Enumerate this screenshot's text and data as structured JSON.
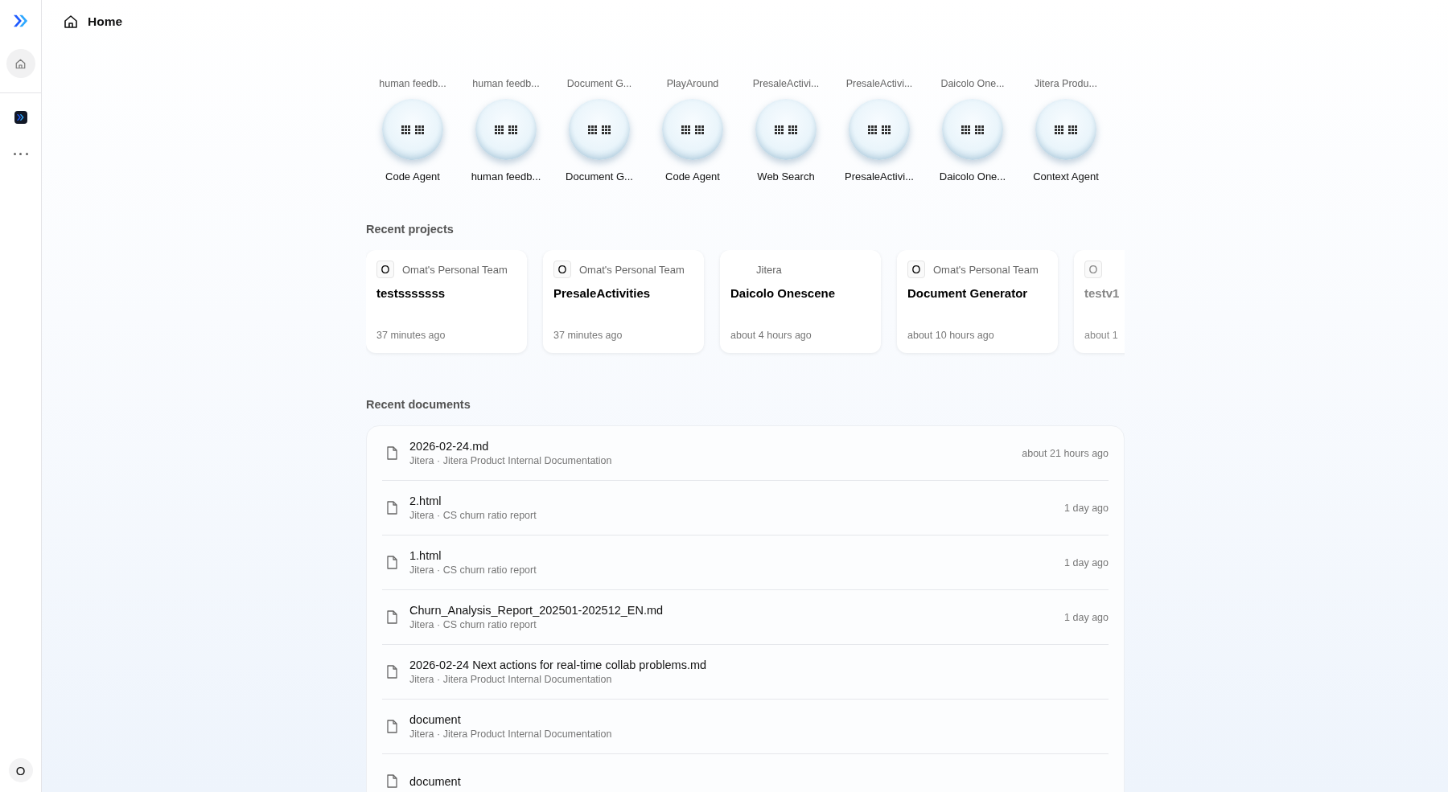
{
  "sidebar": {
    "items": [
      {
        "kind": "home",
        "selected": true
      },
      {
        "kind": "app",
        "selected": false
      },
      {
        "kind": "more",
        "selected": false
      }
    ],
    "avatar": "O"
  },
  "header": {
    "title": "Home"
  },
  "agents": [
    {
      "project": "human feedb...",
      "name": "Code Agent"
    },
    {
      "project": "human feedb...",
      "name": "human feedb..."
    },
    {
      "project": "Document G...",
      "name": "Document G..."
    },
    {
      "project": "PlayAround",
      "name": "Code Agent"
    },
    {
      "project": "PresaleActivi...",
      "name": "Web Search"
    },
    {
      "project": "PresaleActivi...",
      "name": "PresaleActivi..."
    },
    {
      "project": "Daicolo One...",
      "name": "Daicolo One..."
    },
    {
      "project": "Jitera Produ...",
      "name": "Context Agent"
    }
  ],
  "recent_projects": {
    "title": "Recent projects",
    "items": [
      {
        "team_initial": "O",
        "team": "Omat's Personal Team",
        "name": "testsssssss",
        "time": "37 minutes ago"
      },
      {
        "team_initial": "O",
        "team": "Omat's Personal Team",
        "name": "PresaleActivities",
        "time": "37 minutes ago"
      },
      {
        "team": "Jitera",
        "name": "Daicolo Onescene",
        "time": "about 4 hours ago"
      },
      {
        "team_initial": "O",
        "team": "Omat's Personal Team",
        "name": "Document Generator",
        "time": "about 10 hours ago"
      },
      {
        "team_initial": "O",
        "name": "testv1",
        "time": "about 1"
      }
    ]
  },
  "recent_documents": {
    "title": "Recent documents",
    "items": [
      {
        "name": "2026-02-24.md",
        "path": "Jitera · Jitera Product Internal Documentation",
        "time": "about 21 hours ago"
      },
      {
        "name": "2.html",
        "path": "Jitera · CS churn ratio report",
        "time": "1 day ago"
      },
      {
        "name": "1.html",
        "path": "Jitera · CS churn ratio report",
        "time": "1 day ago"
      },
      {
        "name": "Churn_Analysis_Report_202501-202512_EN.md",
        "path": "Jitera · CS churn ratio report",
        "time": "1 day ago"
      },
      {
        "name": "2026-02-24 Next actions for real-time collab problems.md",
        "path": "Jitera · Jitera Product Internal Documentation"
      },
      {
        "name": "document",
        "path": "Jitera · Jitera Product Internal Documentation"
      },
      {
        "name": "document"
      }
    ]
  }
}
